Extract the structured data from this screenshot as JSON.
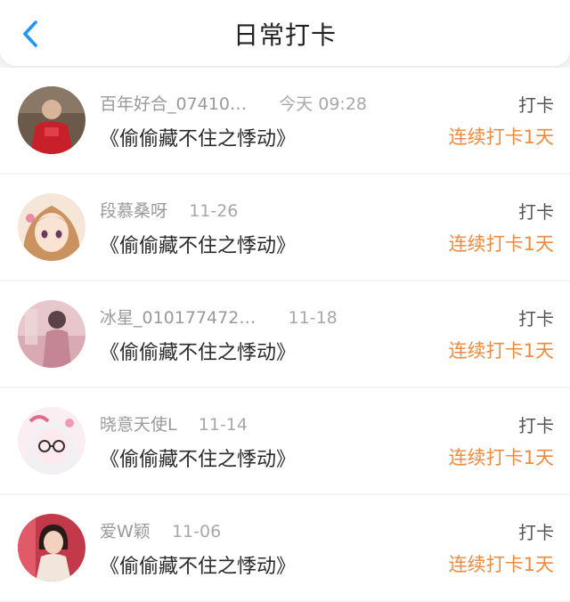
{
  "header": {
    "title": "日常打卡",
    "back_icon": "chevron-left-icon",
    "accent": "#2196f3"
  },
  "colors": {
    "streak": "#f08a3c",
    "background": "#f4f4f6"
  },
  "entries": [
    {
      "name": "百年好合_07410…",
      "time": "今天 09:28",
      "book": "《偷偷藏不住之悸动》",
      "action": "打卡",
      "streak": "连续打卡1天"
    },
    {
      "name": "段慕桑呀",
      "time": "11-26",
      "book": "《偷偷藏不住之悸动》",
      "action": "打卡",
      "streak": "连续打卡1天"
    },
    {
      "name": "冰星_010177472…",
      "time": "11-18",
      "book": "《偷偷藏不住之悸动》",
      "action": "打卡",
      "streak": "连续打卡1天"
    },
    {
      "name": "晓意天使L",
      "time": "11-14",
      "book": "《偷偷藏不住之悸动》",
      "action": "打卡",
      "streak": "连续打卡1天"
    },
    {
      "name": "爱W颖",
      "time": "11-06",
      "book": "《偷偷藏不住之悸动》",
      "action": "打卡",
      "streak": "连续打卡1天"
    }
  ]
}
